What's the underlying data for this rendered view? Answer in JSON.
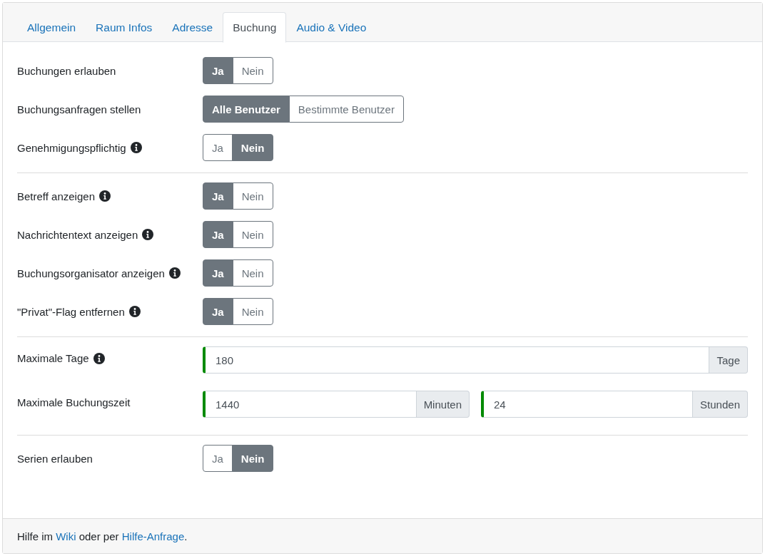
{
  "tabs": [
    {
      "label": "Allgemein",
      "selected": false
    },
    {
      "label": "Raum Infos",
      "selected": false
    },
    {
      "label": "Adresse",
      "selected": false
    },
    {
      "label": "Buchung",
      "selected": true
    },
    {
      "label": "Audio & Video",
      "selected": false
    }
  ],
  "sections": [
    {
      "rows": [
        {
          "kind": "toggle",
          "label": "Buchungen erlauben",
          "info": false,
          "options": [
            {
              "label": "Ja",
              "selected": true
            },
            {
              "label": "Nein",
              "selected": false
            }
          ]
        },
        {
          "kind": "toggle",
          "label": "Buchungsanfragen stellen",
          "info": false,
          "options": [
            {
              "label": "Alle Benutzer",
              "selected": true
            },
            {
              "label": "Bestimmte Benutzer",
              "selected": false
            }
          ]
        },
        {
          "kind": "toggle",
          "label": "Genehmigungspflichtig",
          "info": true,
          "options": [
            {
              "label": "Ja",
              "selected": false
            },
            {
              "label": "Nein",
              "selected": true
            }
          ]
        }
      ]
    },
    {
      "rows": [
        {
          "kind": "toggle",
          "label": "Betreff anzeigen",
          "info": true,
          "options": [
            {
              "label": "Ja",
              "selected": true
            },
            {
              "label": "Nein",
              "selected": false
            }
          ]
        },
        {
          "kind": "toggle",
          "label": "Nachrichtentext anzeigen",
          "info": true,
          "options": [
            {
              "label": "Ja",
              "selected": true
            },
            {
              "label": "Nein",
              "selected": false
            }
          ]
        },
        {
          "kind": "toggle",
          "label": "Buchungsorganisator anzeigen",
          "info": true,
          "options": [
            {
              "label": "Ja",
              "selected": true
            },
            {
              "label": "Nein",
              "selected": false
            }
          ]
        },
        {
          "kind": "toggle",
          "label": "\"Privat\"-Flag entfernen",
          "info": true,
          "options": [
            {
              "label": "Ja",
              "selected": true
            },
            {
              "label": "Nein",
              "selected": false
            }
          ]
        }
      ]
    },
    {
      "rows": [
        {
          "kind": "inputs",
          "label": "Maximale Tage",
          "info": true,
          "fields": [
            {
              "value": "180",
              "unit": "Tage"
            }
          ]
        },
        {
          "kind": "inputs",
          "label": "Maximale Buchungszeit",
          "info": false,
          "fields": [
            {
              "value": "1440",
              "unit": "Minuten"
            },
            {
              "value": "24",
              "unit": "Stunden"
            }
          ]
        }
      ]
    },
    {
      "rows": [
        {
          "kind": "toggle",
          "label": "Serien erlauben",
          "info": false,
          "options": [
            {
              "label": "Ja",
              "selected": false
            },
            {
              "label": "Nein",
              "selected": true
            }
          ]
        }
      ]
    }
  ],
  "footer": [
    {
      "kind": "text",
      "text": "Hilfe im "
    },
    {
      "kind": "link",
      "text": "Wiki"
    },
    {
      "kind": "text",
      "text": " oder per "
    },
    {
      "kind": "link",
      "text": "Hilfe-Anfrage"
    },
    {
      "kind": "text",
      "text": "."
    }
  ]
}
